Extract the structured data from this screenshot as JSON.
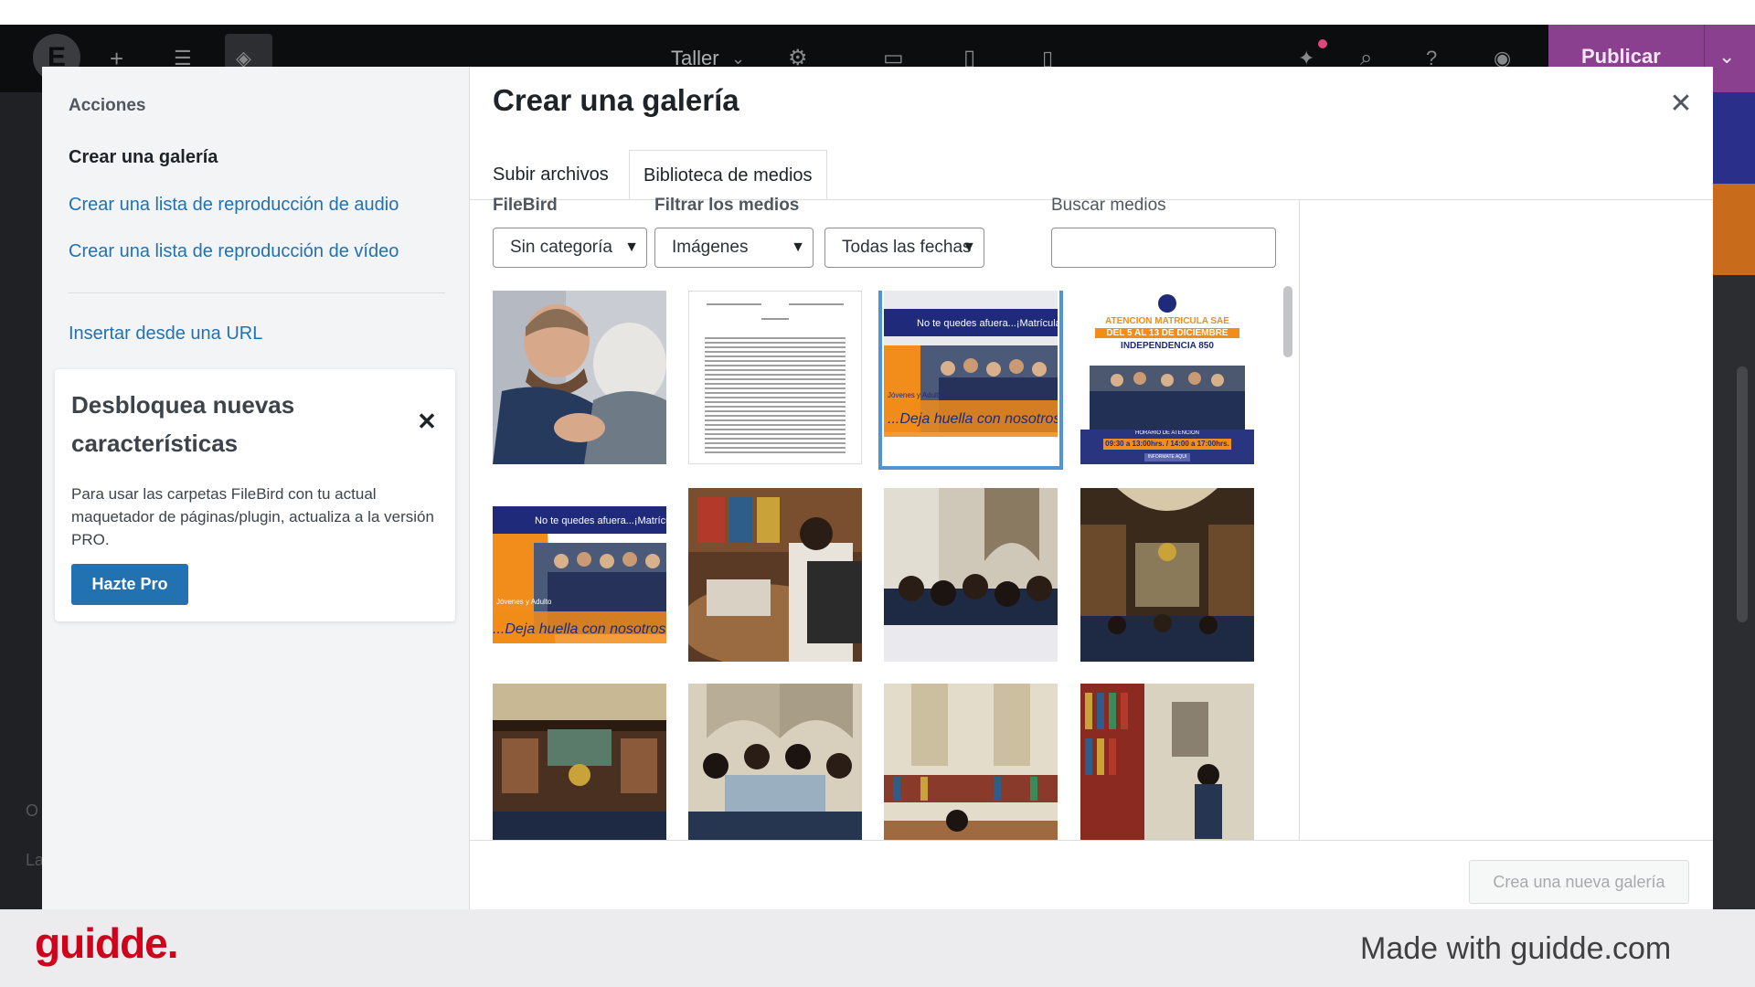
{
  "editor": {
    "page_title": "Taller",
    "publish_label": "Publicar",
    "left_hint_1": "O",
    "left_hint_2": "La",
    "colors": {
      "bar": "#0c0d0e",
      "publish": "#8a3f8f"
    }
  },
  "menu": {
    "heading": "Acciones",
    "items": [
      {
        "label": "Crear una galería"
      },
      {
        "label": "Crear una lista de reproducción de audio"
      },
      {
        "label": "Crear una lista de reproducción de vídeo"
      }
    ],
    "insert_url": "Insertar desde una URL"
  },
  "promo": {
    "title": "Desbloquea nuevas características",
    "body": "Para usar las carpetas FileBird con tu actual maquetador de páginas/plugin, actualiza a la versión PRO.",
    "button": "Hazte Pro"
  },
  "modal": {
    "title": "Crear una galería",
    "tabs": [
      {
        "label": "Subir archivos"
      },
      {
        "label": "Biblioteca de medios"
      }
    ],
    "filters": {
      "filebird_label": "FileBird",
      "filebird_value": "Sin categoría",
      "media_label": "Filtrar los medios",
      "type_value": "Imágenes",
      "date_value": "Todas las fechas",
      "search_label": "Buscar medios",
      "search_value": ""
    },
    "thumb_texts": {
      "banner_title": "No te quedes afuera...¡Matrícula",
      "banner_slogan": "...Deja huella con nosotros",
      "banner_side": "Jóvenes y Adultos",
      "poster_line1": "ATENCIÓN MATRÍCULA SAE",
      "poster_line2": "DEL 5 AL 13 DE DICIEMBRE",
      "poster_line3": "INDEPENDENCIA 850",
      "poster_hours_label": "HORARIO DE ATENCIÓN",
      "poster_hours": "09:30 a 13:00hrs. / 14:00 a 17:00hrs.",
      "poster_button": "INFÓRMATE AQUÍ"
    },
    "create_button": "Crea una nueva galería"
  },
  "brand": {
    "logo": "guidde.",
    "made_with": "Made with guidde.com",
    "color": "#d0021b"
  }
}
